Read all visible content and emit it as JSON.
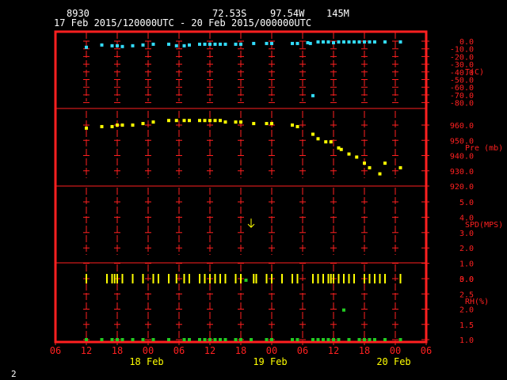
{
  "header": {
    "station": "8930",
    "lat": "72.53S",
    "lon": "97.54W",
    "elev": "145M",
    "period": "17 Feb 2015/120000UTC - 20 Feb 2015/000000UTC"
  },
  "corner_label": "2",
  "colors": {
    "frame": "#ff2020",
    "grid": "#ff2020",
    "axis_text": "#ff2020",
    "temperature": "#33ddff",
    "pressure": "#ffff00",
    "wind": "#ffff00",
    "rh": "#22cc22",
    "header_text": "#ffffff",
    "date_text": "#ffff00"
  },
  "chart_data": {
    "type": "scatter",
    "x_axis": {
      "tick_labels": [
        "06",
        "12",
        "18",
        "00",
        "06",
        "12",
        "18",
        "00",
        "06",
        "12",
        "18",
        "00",
        "06"
      ],
      "date_labels": [
        "18 Feb",
        "19 Feb",
        "20 Feb"
      ],
      "range_hours": [
        6,
        78
      ]
    },
    "panels": [
      {
        "label": "T(C)",
        "ticks": [
          "0.0",
          "-10.0",
          "-20.0",
          "-30.0",
          "-40.0",
          "-50.0",
          "-60.0",
          "-70.0",
          "-80.0"
        ],
        "ylim": [
          -80,
          0
        ],
        "series": [
          {
            "marker": "temperature",
            "x": [
              12,
              15,
              17,
              18,
              19,
              21,
              23,
              25,
              28,
              29.5,
              31,
              32,
              34,
              35,
              36,
              37,
              38,
              39,
              41,
              42,
              44.5,
              47,
              48,
              52,
              53,
              55,
              55.5,
              56,
              57,
              58,
              59,
              60,
              61,
              62,
              63,
              64,
              65,
              66,
              67,
              68,
              70,
              73
            ],
            "y": [
              -8,
              -5,
              -6,
              -6,
              -7,
              -6,
              -5,
              -4,
              -4,
              -6,
              -6,
              -5,
              -4,
              -4,
              -4,
              -4,
              -4,
              -4,
              -4,
              -4,
              -3,
              -3,
              -3,
              -3,
              -3,
              -2,
              -3,
              -71,
              -1,
              -1,
              -1,
              -2,
              -1,
              -1,
              -1,
              -1,
              -1,
              -1,
              -1,
              -1,
              -1,
              -1
            ]
          }
        ]
      },
      {
        "label": "Pre (mb)",
        "ticks": [
          "960.0",
          "950.0",
          "940.0",
          "930.0",
          "920.0"
        ],
        "ylim": [
          920,
          960
        ],
        "series": [
          {
            "marker": "pressure",
            "x": [
              12,
              15,
              17,
              18,
              19,
              21,
              23,
              25,
              28,
              29.5,
              31,
              32,
              34,
              35,
              36,
              37,
              38,
              39,
              41,
              42,
              44.5,
              47,
              48,
              52,
              53,
              56,
              57,
              58.5,
              59.5,
              61,
              61.5,
              63,
              64.5,
              66,
              67,
              69,
              70,
              73
            ],
            "y": [
              958,
              959,
              959,
              960,
              960,
              960,
              961,
              962,
              963,
              963,
              963,
              963,
              963,
              963,
              963,
              963,
              963,
              962,
              962,
              962,
              961,
              961,
              961,
              960,
              959,
              954,
              951,
              949,
              949,
              945,
              944,
              941,
              939,
              935,
              932,
              928,
              935,
              932
            ]
          }
        ]
      },
      {
        "label": "SPD(MPS)",
        "ticks": [
          "5.0",
          "4.0",
          "3.0",
          "2.0",
          "1.0",
          "0.0"
        ],
        "ylim": [
          0,
          5
        ],
        "wind_arrow": {
          "x": 44,
          "y": 3.6
        },
        "calm_x": [
          12,
          16,
          17,
          17.5,
          18,
          19,
          21,
          23,
          25,
          26,
          28,
          29.5,
          31,
          32,
          34,
          35,
          36,
          37,
          38,
          39,
          41,
          42,
          44.5,
          45,
          47,
          48,
          50,
          52,
          53,
          56,
          57,
          58,
          59,
          59.5,
          60,
          61,
          62,
          63,
          64,
          66,
          67,
          68,
          69,
          70,
          73
        ]
      },
      {
        "label": "RH(%)",
        "ticks": [
          "3.0",
          "2.5",
          "2.0",
          "1.5",
          "1.0"
        ],
        "ylim": [
          1.0,
          3.0
        ],
        "series": [
          {
            "marker": "rh",
            "x": [
              12,
              15,
              17,
              18,
              19,
              21,
              23,
              25,
              28,
              31,
              32,
              34,
              35,
              36,
              37,
              38,
              39,
              41,
              42,
              43,
              44,
              47,
              48,
              52,
              53,
              56,
              57,
              58,
              59,
              60,
              61,
              62,
              63,
              65,
              66,
              67,
              68,
              70,
              73
            ],
            "y": [
              1,
              1,
              1,
              1,
              1,
              1,
              1,
              1,
              1,
              1,
              1,
              1,
              1,
              1,
              1,
              1,
              1,
              1,
              1,
              2.95,
              1,
              1,
              1,
              1,
              1,
              1,
              1,
              1,
              1,
              1,
              1,
              1.97,
              1,
              1,
              1,
              1,
              1,
              1,
              1
            ]
          }
        ]
      }
    ]
  }
}
